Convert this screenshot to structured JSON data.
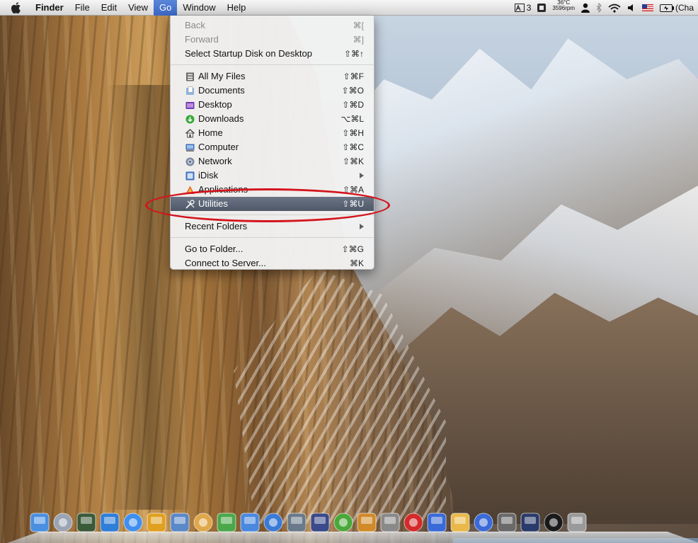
{
  "menubar": {
    "app_name": "Finder",
    "menus": [
      "File",
      "Edit",
      "View",
      "Go",
      "Window",
      "Help"
    ],
    "active_menu": "Go",
    "status": {
      "spaces_count": "3",
      "temperature": "36°C",
      "fan_speed": "3596rpm",
      "charge_text": "(Cha"
    }
  },
  "go_menu": {
    "items": [
      {
        "label": "Back",
        "shortcut": "⌘[",
        "disabled": true
      },
      {
        "label": "Forward",
        "shortcut": "⌘]",
        "disabled": true
      },
      {
        "label": "Select Startup Disk on Desktop",
        "shortcut": "⇧⌘↑"
      },
      {
        "label": "All My Files",
        "shortcut": "⇧⌘F",
        "icon": "all-my-files-icon"
      },
      {
        "label": "Documents",
        "shortcut": "⇧⌘O",
        "icon": "documents-icon"
      },
      {
        "label": "Desktop",
        "shortcut": "⇧⌘D",
        "icon": "desktop-icon"
      },
      {
        "label": "Downloads",
        "shortcut": "⌥⌘L",
        "icon": "downloads-icon"
      },
      {
        "label": "Home",
        "shortcut": "⇧⌘H",
        "icon": "home-icon"
      },
      {
        "label": "Computer",
        "shortcut": "⇧⌘C",
        "icon": "computer-icon"
      },
      {
        "label": "Network",
        "shortcut": "⇧⌘K",
        "icon": "network-icon"
      },
      {
        "label": "iDisk",
        "shortcut": "",
        "icon": "idisk-icon",
        "submenu": true
      },
      {
        "label": "Applications",
        "shortcut": "⇧⌘A",
        "icon": "applications-icon"
      },
      {
        "label": "Utilities",
        "shortcut": "⇧⌘U",
        "icon": "utilities-icon",
        "selected": true
      },
      {
        "label": "Recent Folders",
        "shortcut": "",
        "submenu": true
      },
      {
        "label": "Go to Folder...",
        "shortcut": "⇧⌘G"
      },
      {
        "label": "Connect to Server...",
        "shortcut": "⌘K"
      }
    ]
  },
  "colors": {
    "menu_highlight": "#3a66c4",
    "selected_item": "#4e5868",
    "annotation": "#d4141c"
  },
  "dock": {
    "icons": [
      "finder-icon",
      "launchpad-icon",
      "activity-monitor-icon",
      "app-store-icon",
      "safari-icon",
      "chrome-icon",
      "preview-icon",
      "pages-icon",
      "garageband-icon",
      "camino-icon",
      "itunes-icon",
      "iphoto-icon",
      "aperture-icon",
      "numbers-icon",
      "keynote-icon",
      "system-preferences-icon",
      "acrobat-icon",
      "xcode-icon",
      "textedit-icon",
      "notes-icon",
      "time-machine-icon",
      "cameras-icon",
      "terminal-icon",
      "trash-icon"
    ]
  }
}
